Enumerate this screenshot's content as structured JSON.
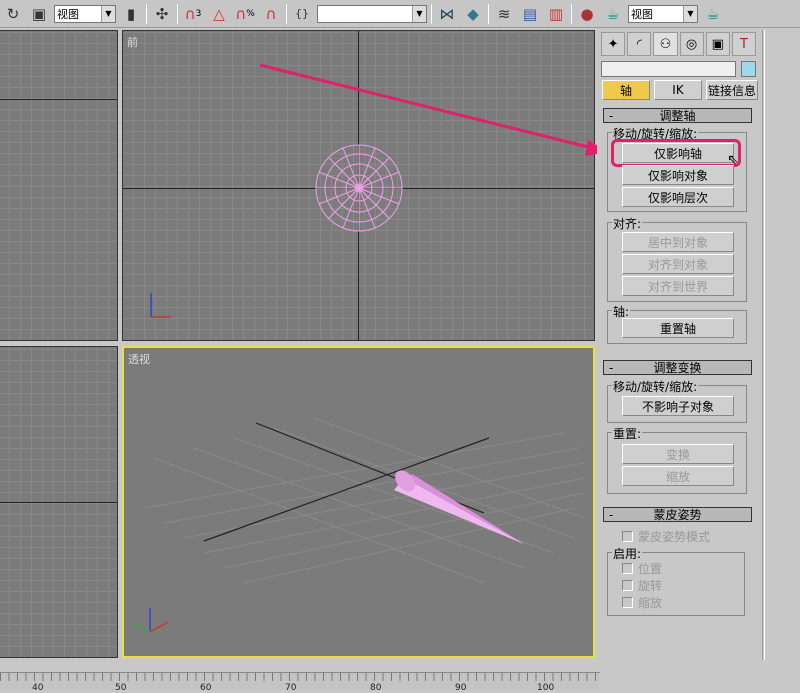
{
  "toolbar": {
    "view_combo_1": "视图",
    "view_combo_2": "视图",
    "snap_angle": "3",
    "snap_percent": "%",
    "named_selection": "",
    "icons": [
      "undo-icon",
      "select-object-icon",
      "reference-coord-icon",
      "pivot-icon",
      "snap-3d-icon",
      "angle-snap-icon",
      "percent-snap-icon",
      "spinner-snap-icon",
      "named-selection-icon",
      "mirror-icon",
      "align-icon",
      "layer-icon",
      "curve-editor-icon",
      "schematic-icon",
      "material-editor-icon",
      "render-setup-icon",
      "render-icon"
    ]
  },
  "viewports": {
    "front_label": "前",
    "perspective_label": "透视",
    "active_border": "#e8e040"
  },
  "annotation": {
    "arrow_color": "#e0206a"
  },
  "panel": {
    "tabs": [
      "create-icon",
      "modify-icon",
      "hierarchy-icon",
      "motion-icon",
      "display-icon",
      "utilities-icon"
    ],
    "sub_tabs": [
      "轴",
      "IK",
      "链接信息"
    ],
    "adjust_pivot": {
      "title": "调整轴",
      "minus": "-",
      "group_move": "移动/旋转/缩放:",
      "btn_pivot_only": "仅影响轴",
      "btn_object_only": "仅影响对象",
      "btn_hierarchy_only": "仅影响层次",
      "group_align": "对齐:",
      "btn_center": "居中到对象",
      "btn_align_obj": "对齐到对象",
      "btn_align_world": "对齐到世界",
      "group_pivot": "轴:",
      "btn_reset": "重置轴"
    },
    "adjust_transform": {
      "title": "调整变换",
      "minus": "-",
      "group_move": "移动/旋转/缩放:",
      "btn_dont_affect": "不影响子对象",
      "group_reset": "重置:",
      "btn_transform": "变换",
      "btn_scale": "缩放"
    },
    "skin_pose": {
      "title": "蒙皮姿势",
      "minus": "-",
      "mode": "蒙皮姿势模式",
      "group_enable": "启用:",
      "position": "位置",
      "rotation": "旋转",
      "scale": "缩放"
    }
  },
  "timeline": {
    "ticks": [
      "40",
      "50",
      "60",
      "70",
      "80",
      "90",
      "100"
    ]
  }
}
